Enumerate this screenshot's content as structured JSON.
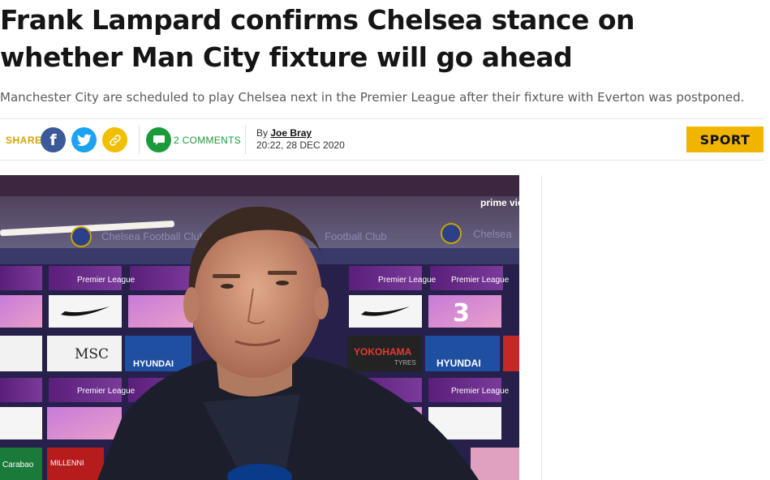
{
  "article": {
    "headline": "Frank Lampard confirms Chelsea stance on whether Man City fixture will go ahead",
    "standfirst": "Manchester City are scheduled to play Chelsea next in the Premier League after their fixture with Everton was postponed."
  },
  "meta": {
    "share_label": "SHARE",
    "share_icons": [
      "facebook-icon",
      "twitter-icon",
      "link-icon"
    ],
    "comments_label": "2 COMMENTS",
    "by_prefix": "By",
    "author": "Joe Bray",
    "timestamp": "20:22, 28 DEC 2020",
    "section_badge": "SPORT"
  },
  "media": {
    "watermark": "prime vide",
    "board_club_text_1": "Chelsea Football Club",
    "board_club_text_2": "Football Club",
    "board_club_text_3": "Chelsea",
    "premier_league_label": "Premier League",
    "sponsor_msc": "MSC",
    "sponsor_hyundai": "HYUNDAI",
    "sponsor_yokohama": "YOKOHAMA",
    "sponsor_yokohama_sub": "TYRES",
    "sponsor_carabao": "Carabao",
    "sponsor_millennium": "MILLENNI",
    "sponsor_three": "3"
  },
  "colors": {
    "share_gold": "#d3a400",
    "facebook": "#3b5a9a",
    "twitter": "#1da1f2",
    "link": "#f1be00",
    "comments_green": "#1a9a3a",
    "sport_badge": "#f1b500"
  }
}
